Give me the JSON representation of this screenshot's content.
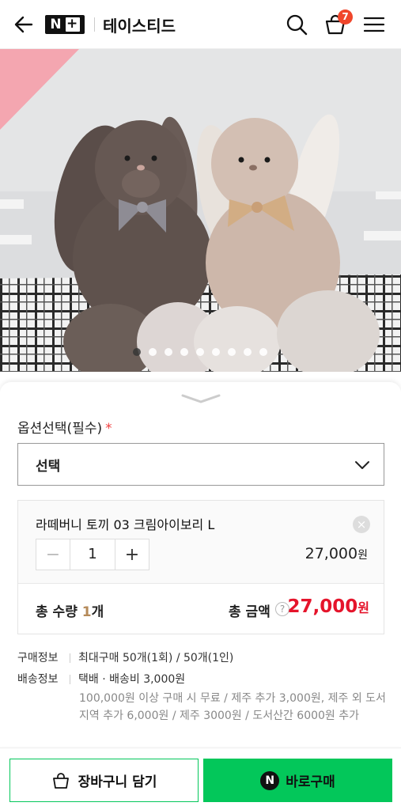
{
  "header": {
    "logo_text": "N",
    "logo_plus": "+",
    "store_name": "테이스티드",
    "cart_count": "7"
  },
  "gallery": {
    "total_dots": 9,
    "active_index": 0
  },
  "option": {
    "label": "옵션선택(필수)",
    "required_mark": "*",
    "select_value": "선택"
  },
  "selected_item": {
    "name": "라떼버니 토끼 03 크림아이보리 L",
    "remove_icon": "×",
    "minus": "−",
    "quantity": "1",
    "plus": "+",
    "price": "27,000",
    "price_unit": "원"
  },
  "total": {
    "qty_label": "총 수량",
    "qty_value": "1",
    "qty_unit": "개",
    "amount_label": "총 금액",
    "help_icon": "?",
    "amount": "27,000",
    "amount_unit": "원"
  },
  "purchase_info": {
    "label": "구매정보",
    "value": "최대구매 50개(1회) / 50개(1인)"
  },
  "shipping_info": {
    "label": "배송정보",
    "value": "택배 · 배송비 3,000원",
    "note_line1": "100,000원 이상 구매 시 무료 / 제주 추가 3,000원, 제주 외 도서",
    "note_line2": "지역 추가 6,000원 / 제주 3000원 / 도서산간 6000원 추가"
  },
  "buttons": {
    "cart_label": "장바구니 담기",
    "buy_badge": "N",
    "buy_label": "바로구매"
  },
  "colors": {
    "accent_green": "#03c75a",
    "price_red": "#e5142b",
    "badge_orange": "#f0462b"
  }
}
